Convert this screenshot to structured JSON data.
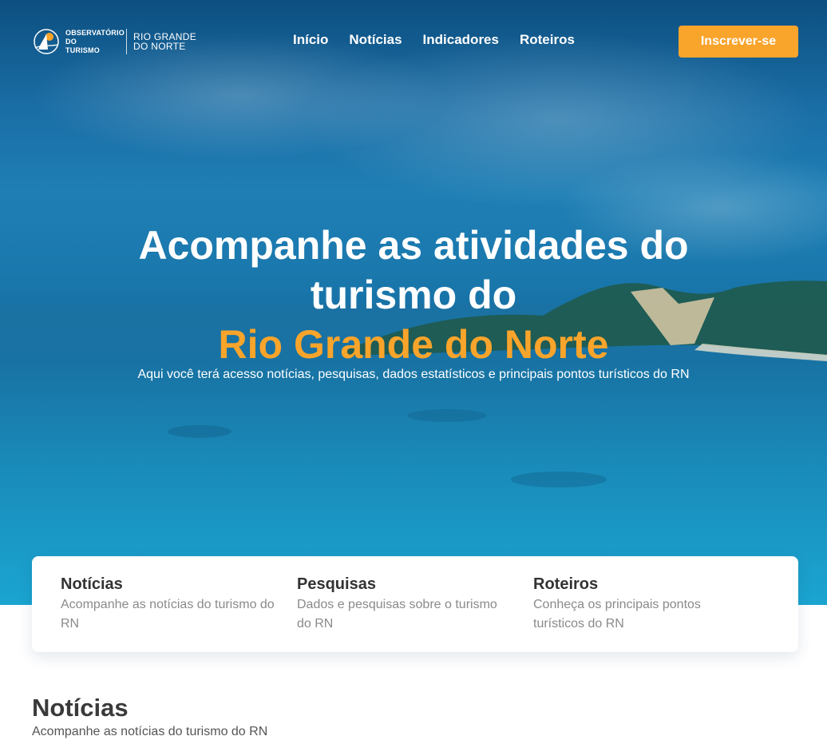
{
  "header": {
    "logo_line1": "OBSERVATÓRIO DO",
    "logo_line2": "TURISMO",
    "logo_state_line1": "RIO GRANDE",
    "logo_state_line2": "DO NORTE",
    "nav": [
      "Início",
      "Notícias",
      "Indicadores",
      "Roteiros"
    ],
    "cta_label": "Inscrever-se"
  },
  "hero": {
    "title_line1": "Acompanhe as atividades do",
    "title_line2": "turismo do",
    "title_accent": "Rio Grande do Norte",
    "subtitle": "Aqui você terá acesso notícias, pesquisas, dados estatísticos e principais pontos turísticos do RN"
  },
  "cards": [
    {
      "title": "Notícias",
      "text": "Acompanhe as notícias do turismo do RN"
    },
    {
      "title": "Pesquisas",
      "text": "Dados e pesquisas sobre o turismo do RN"
    },
    {
      "title": "Roteiros",
      "text": "Conheça os principais pontos turísticos do RN"
    }
  ],
  "section": {
    "title": "Notícias",
    "subtitle": "Acompanhe as notícias do turismo do RN"
  },
  "colors": {
    "accent": "#f9a42b",
    "hero_blue": "#1a78ad"
  }
}
